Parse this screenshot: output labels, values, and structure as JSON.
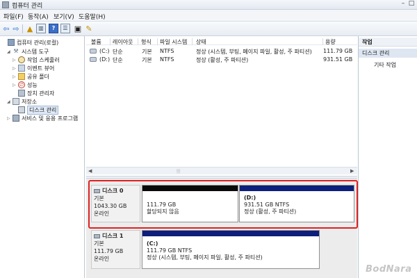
{
  "window": {
    "title": "컴퓨터 관리",
    "min": "–",
    "max": "□"
  },
  "menu": [
    "파일(F)",
    "동작(A)",
    "보기(V)",
    "도움말(H)"
  ],
  "toolbar_icons": [
    "back-arrow-icon",
    "forward-arrow-icon",
    "up-folder-icon",
    "console-tree-icon",
    "help-icon",
    "list-view-icon",
    "properties-icon",
    "export-icon"
  ],
  "tree": [
    {
      "label": "컴퓨터 관리(로컬)",
      "icon": "computer-icon"
    },
    {
      "label": "시스템 도구",
      "icon": "tools-icon"
    },
    {
      "label": "작업 스케줄러",
      "icon": "clock-icon"
    },
    {
      "label": "이벤트 뷰어",
      "icon": "event-viewer-icon"
    },
    {
      "label": "공유 폴더",
      "icon": "shared-folder-icon"
    },
    {
      "label": "성능",
      "icon": "performance-icon"
    },
    {
      "label": "장치 관리자",
      "icon": "device-manager-icon"
    },
    {
      "label": "저장소",
      "icon": "storage-icon"
    },
    {
      "label": "디스크 관리",
      "icon": "disk-management-icon"
    },
    {
      "label": "서비스 및 응용 프로그램",
      "icon": "services-icon"
    }
  ],
  "volume_table": {
    "headers": [
      "볼륨",
      "레이아웃",
      "형식",
      "파일 시스템",
      "상태",
      "용량"
    ],
    "rows": [
      {
        "volume": "(C:)",
        "layout": "단순",
        "type": "기본",
        "fs": "NTFS",
        "status": "정상 (시스템, 부팅, 페이지 파일, 활성, 주 파티션)",
        "capacity": "111.79 GB"
      },
      {
        "volume": "(D:)",
        "layout": "단순",
        "type": "기본",
        "fs": "NTFS",
        "status": "정상 (활성, 주 파티션)",
        "capacity": "931.51 GB"
      }
    ]
  },
  "scroll": {
    "left": "◀",
    "right": "▶",
    "grip": "⦙⦙⦙"
  },
  "disks": [
    {
      "name": "디스크 0",
      "type": "기본",
      "size": "1043.30 GB",
      "state": "온라인",
      "partitions": [
        {
          "size": "111.79 GB",
          "status": "할당되지 않음",
          "bar": "#0a0a0a"
        },
        {
          "label": "(D:)",
          "size": "931.51 GB NTFS",
          "status": "정상 (활성, 주 파티션)",
          "bar": "#0d1f7a"
        }
      ]
    },
    {
      "name": "디스크 1",
      "type": "기본",
      "size": "111.79 GB",
      "state": "온라인",
      "partitions": [
        {
          "label": "(C:)",
          "size": "111.79 GB NTFS",
          "status": "정상 (시스템, 부팅, 페이지 파일, 활성, 주 파티션)",
          "bar": "#0d1f7a"
        }
      ]
    }
  ],
  "actions": {
    "title": "작업",
    "section": "디스크 관리",
    "item": "기타 작업"
  },
  "watermark": "BodNara",
  "colors": {
    "highlight": "#e02020",
    "primary_partition": "#0d1f7a",
    "unallocated": "#0a0a0a"
  }
}
